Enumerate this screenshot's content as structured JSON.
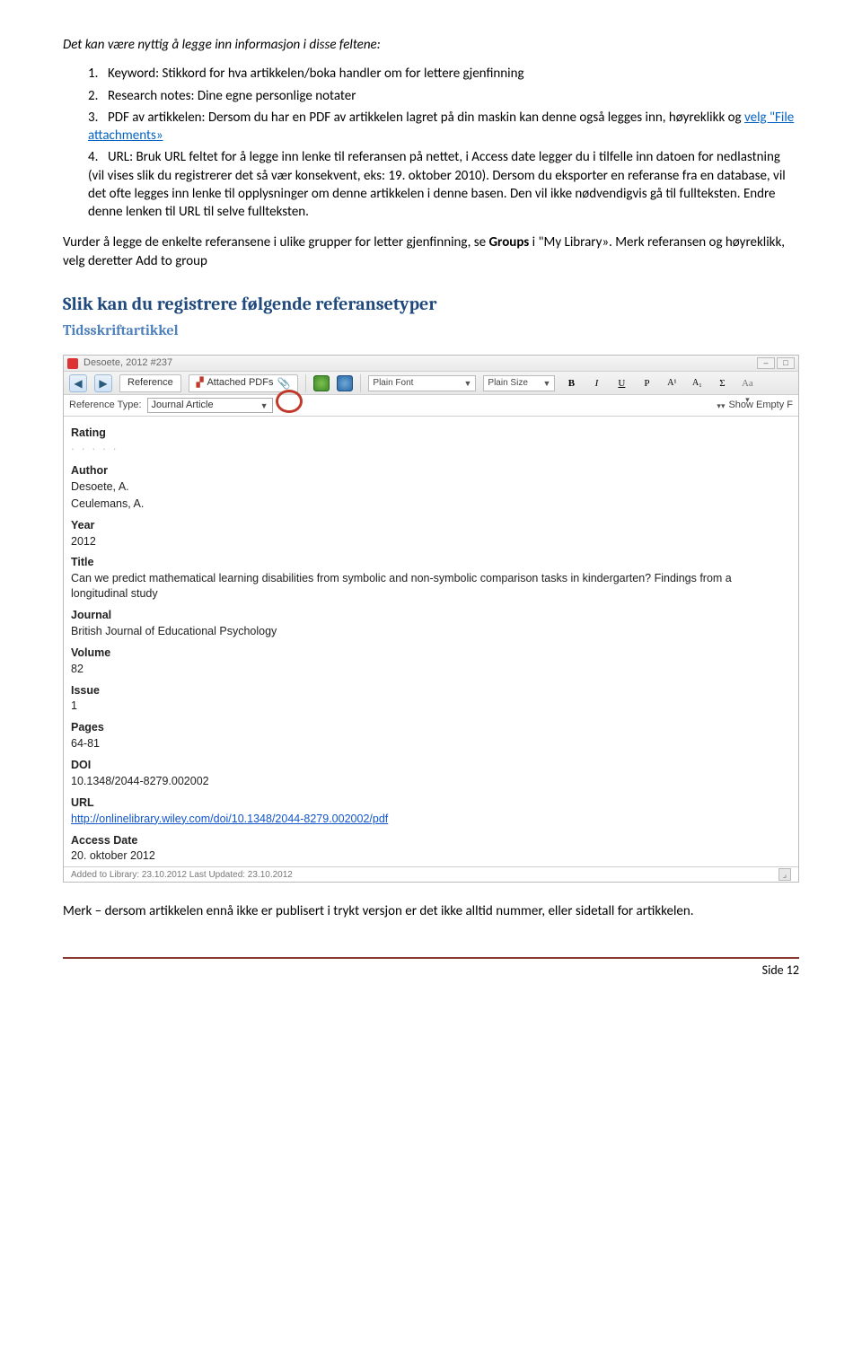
{
  "intro_line": "Det kan være nyttig å legge inn informasjon i disse feltene:",
  "list": {
    "item1_num": "1.",
    "item1_text": "Keyword: Stikkord for hva artikkelen/boka handler om for lettere gjenfinning",
    "item2_num": "2.",
    "item2_text": "Research notes: Dine egne personlige notater",
    "item3_num": "3.",
    "item3_pre": "PDF av artikkelen: Dersom du har en PDF av artikkelen lagret på din maskin kan denne også legges inn, høyreklikk og ",
    "item3_link": "velg \"File attachments»",
    "item4_num": "4.",
    "item4_text": "URL: Bruk URL feltet for å legge inn lenke til referansen på nettet, i Access date legger du i tilfelle inn datoen for nedlastning (vil vises slik du registrerer det så vær konsekvent, eks: 19. oktober 2010). Dersom du eksporter en referanse fra en database, vil det ofte legges inn lenke til opplysninger om denne artikkelen i denne basen. Den vil ikke nødvendigvis gå til fullteksten. Endre denne lenken til URL til selve fullteksten."
  },
  "para2_pre": "Vurder å legge de enkelte referansene i ulike grupper for letter gjenfinning, se ",
  "para2_bold": "Groups",
  "para2_post": " i \"My Library». Merk referansen og høyreklikk, velg deretter Add to group",
  "heading_h2": "Slik kan du registrere følgende referansetyper",
  "heading_h3": "Tidsskriftartikkel",
  "endnote": {
    "title": "Desoete, 2012 #237",
    "tab_reference": "Reference",
    "tab_attached": "Attached PDFs",
    "font_name": "Plain Font",
    "font_size": "Plain Size",
    "ref_type_label": "Reference Type:",
    "ref_type_value": "Journal Article",
    "show_empty": "Show Empty F",
    "fields": {
      "rating": "Rating",
      "author": "Author",
      "author_v1": "Desoete, A.",
      "author_v2": "Ceulemans, A.",
      "year": "Year",
      "year_v": "2012",
      "title": "Title",
      "title_v": "Can we predict mathematical learning disabilities from symbolic and non-symbolic comparison tasks in kindergarten? Findings from a longitudinal study",
      "journal": "Journal",
      "journal_v": "British Journal of Educational Psychology",
      "volume": "Volume",
      "volume_v": "82",
      "issue": "Issue",
      "issue_v": "1",
      "pages": "Pages",
      "pages_v": "64-81",
      "doi": "DOI",
      "doi_v": "10.1348/2044-8279.002002",
      "url": "URL",
      "url_v": "http://onlinelibrary.wiley.com/doi/10.1348/2044-8279.002002/pdf",
      "access_date": "Access Date",
      "access_date_v": "20. oktober 2012"
    },
    "footer": "Added to Library: 23.10.2012    Last Updated: 23.10.2012"
  },
  "closing_text": "Merk – dersom artikkelen ennå ikke er publisert i trykt versjon er det ikke alltid nummer, eller sidetall for artikkelen.",
  "page_footer": "Side 12"
}
